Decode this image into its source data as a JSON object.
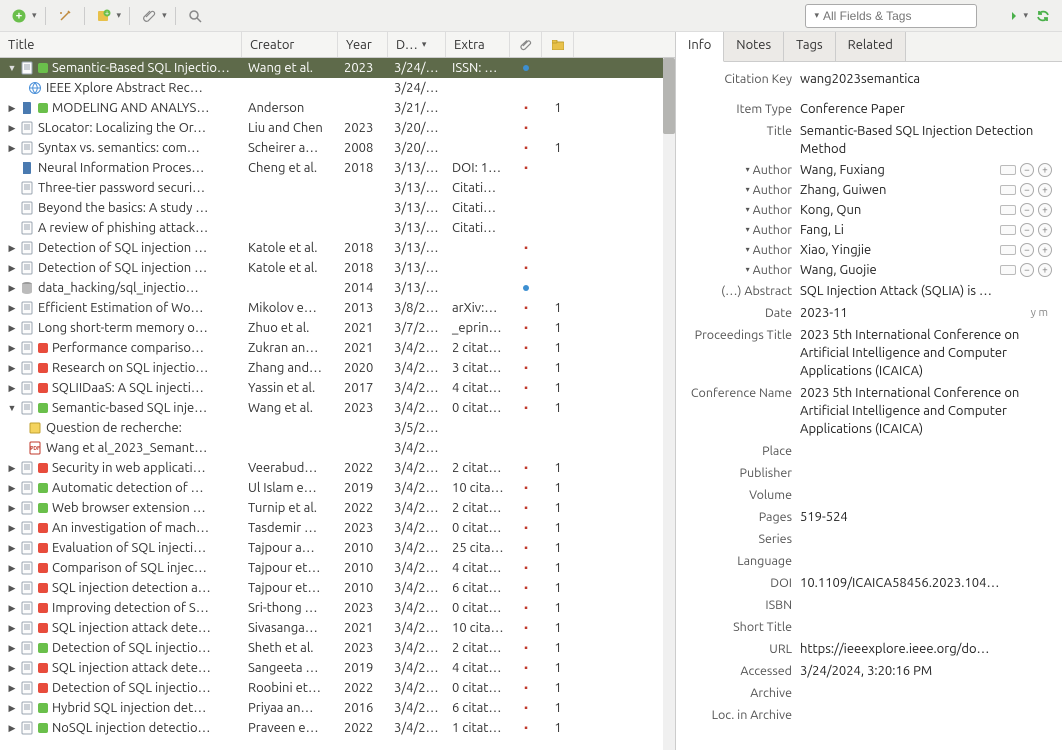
{
  "search": {
    "placeholder": "All Fields & Tags"
  },
  "columns": {
    "title": "Title",
    "creator": "Creator",
    "year": "Year",
    "date": "D…",
    "extra": "Extra"
  },
  "rows": [
    {
      "tw": "▼",
      "ic": "doc",
      "tg": "g",
      "title": "Semantic-Based SQL Injectio…",
      "creator": "Wang et al.",
      "year": "2023",
      "date": "3/24/…",
      "extra": "ISSN: …",
      "att": "dot",
      "f": "",
      "sel": true
    },
    {
      "tw": "",
      "ic": "web",
      "title": "IEEE Xplore Abstract Rec…",
      "creator": "",
      "year": "",
      "date": "3/24/…",
      "extra": "",
      "att": "",
      "f": "",
      "indent": 1
    },
    {
      "tw": "▶",
      "ic": "book",
      "tg": "g",
      "title": "MODELING AND ANALYS…",
      "creator": "Anderson",
      "year": "",
      "date": "3/21/…",
      "extra": "",
      "att": "pdf",
      "f": "1"
    },
    {
      "tw": "▶",
      "ic": "doc",
      "title": "SLocator: Localizing the Or…",
      "creator": "Liu and Chen",
      "year": "2023",
      "date": "3/20/…",
      "extra": "",
      "att": "pdf",
      "f": ""
    },
    {
      "tw": "▶",
      "ic": "doc",
      "title": "Syntax vs. semantics: com…",
      "creator": "Scheirer a…",
      "year": "2008",
      "date": "3/20/…",
      "extra": "",
      "att": "pdf",
      "f": "1"
    },
    {
      "tw": "",
      "ic": "book",
      "title": "Neural Information Proces…",
      "creator": "Cheng et al.",
      "year": "2018",
      "date": "3/13/…",
      "extra": "DOI: 1…",
      "att": "pdf",
      "f": ""
    },
    {
      "tw": "",
      "ic": "doc",
      "title": "Three-tier password securi…",
      "creator": "",
      "year": "",
      "date": "3/13/…",
      "extra": "Citati…",
      "att": "",
      "f": ""
    },
    {
      "tw": "",
      "ic": "doc",
      "title": "Beyond the basics: A study …",
      "creator": "",
      "year": "",
      "date": "3/13/…",
      "extra": "Citati…",
      "att": "",
      "f": ""
    },
    {
      "tw": "",
      "ic": "doc",
      "title": "A review of phishing attack…",
      "creator": "",
      "year": "",
      "date": "3/13/…",
      "extra": "Citati…",
      "att": "",
      "f": ""
    },
    {
      "tw": "▶",
      "ic": "doc",
      "title": "Detection of SQL injection …",
      "creator": "Katole et al.",
      "year": "2018",
      "date": "3/13/…",
      "extra": "",
      "att": "pdf",
      "f": ""
    },
    {
      "tw": "▶",
      "ic": "doc",
      "title": "Detection of SQL injection …",
      "creator": "Katole et al.",
      "year": "2018",
      "date": "3/13/…",
      "extra": "",
      "att": "pdf",
      "f": ""
    },
    {
      "tw": "▶",
      "ic": "db",
      "title": "data_hacking/sql_injectio…",
      "creator": "",
      "year": "2014",
      "date": "3/13/…",
      "extra": "",
      "att": "dot",
      "f": ""
    },
    {
      "tw": "▶",
      "ic": "doc",
      "title": "Efficient Estimation of Wo…",
      "creator": "Mikolov e…",
      "year": "2013",
      "date": "3/8/2…",
      "extra": "arXiv:…",
      "att": "pdf",
      "f": "1"
    },
    {
      "tw": "▶",
      "ic": "doc",
      "title": "Long short-term memory o…",
      "creator": "Zhuo et al.",
      "year": "2021",
      "date": "3/7/2…",
      "extra": "_eprin…",
      "att": "pdf",
      "f": "1"
    },
    {
      "tw": "▶",
      "ic": "doc",
      "tg": "r",
      "title": "Performance compariso…",
      "creator": "Zukran an…",
      "year": "2021",
      "date": "3/4/2…",
      "extra": "2 citat…",
      "att": "pdf",
      "f": "1"
    },
    {
      "tw": "▶",
      "ic": "doc",
      "tg": "r",
      "title": "Research on SQL injectio…",
      "creator": "Zhang and…",
      "year": "2020",
      "date": "3/4/2…",
      "extra": "3 citat…",
      "att": "pdf",
      "f": "1"
    },
    {
      "tw": "▶",
      "ic": "doc",
      "tg": "r",
      "title": "SQLIIDaaS: A SQL injecti…",
      "creator": "Yassin et al.",
      "year": "2017",
      "date": "3/4/2…",
      "extra": "4 citat…",
      "att": "pdf",
      "f": "1"
    },
    {
      "tw": "▼",
      "ic": "doc",
      "tg": "g",
      "title": "Semantic-based SQL inje…",
      "creator": "Wang et al.",
      "year": "2023",
      "date": "3/4/2…",
      "extra": "0 citat…",
      "att": "pdf",
      "f": "1"
    },
    {
      "tw": "",
      "ic": "note",
      "title": "Question de recherche:",
      "creator": "",
      "year": "",
      "date": "3/5/2…",
      "extra": "",
      "att": "",
      "f": "",
      "indent": 1
    },
    {
      "tw": "",
      "ic": "pdf",
      "title": "Wang et al_2023_Semant…",
      "creator": "",
      "year": "",
      "date": "3/4/2…",
      "extra": "",
      "att": "",
      "f": "",
      "indent": 1
    },
    {
      "tw": "▶",
      "ic": "doc",
      "tg": "r",
      "title": "Security in web applicati…",
      "creator": "Veerabud…",
      "year": "2022",
      "date": "3/4/2…",
      "extra": "2 citat…",
      "att": "pdf",
      "f": "1"
    },
    {
      "tw": "▶",
      "ic": "doc",
      "tg": "g",
      "title": "Automatic detection of …",
      "creator": "Ul Islam e…",
      "year": "2019",
      "date": "3/4/2…",
      "extra": "10 cita…",
      "att": "pdf",
      "f": "1"
    },
    {
      "tw": "▶",
      "ic": "doc",
      "tg": "g",
      "title": "Web browser extension …",
      "creator": "Turnip et al.",
      "year": "2022",
      "date": "3/4/2…",
      "extra": "2 citat…",
      "att": "pdf",
      "f": "1"
    },
    {
      "tw": "▶",
      "ic": "doc",
      "tg": "r",
      "title": "An investigation of mach…",
      "creator": "Tasdemir …",
      "year": "2023",
      "date": "3/4/2…",
      "extra": "0 citat…",
      "att": "pdf",
      "f": "1"
    },
    {
      "tw": "▶",
      "ic": "doc",
      "tg": "r",
      "title": "Evaluation of SQL injecti…",
      "creator": "Tajpour a…",
      "year": "2010",
      "date": "3/4/2…",
      "extra": "25 cita…",
      "att": "pdf",
      "f": "1"
    },
    {
      "tw": "▶",
      "ic": "doc",
      "tg": "r",
      "title": "Comparison of SQL injec…",
      "creator": "Tajpour et…",
      "year": "2010",
      "date": "3/4/2…",
      "extra": "4 citat…",
      "att": "pdf",
      "f": "1"
    },
    {
      "tw": "▶",
      "ic": "doc",
      "tg": "r",
      "title": "SQL injection detection a…",
      "creator": "Tajpour et…",
      "year": "2010",
      "date": "3/4/2…",
      "extra": "6 citat…",
      "att": "pdf",
      "f": "1"
    },
    {
      "tw": "▶",
      "ic": "doc",
      "tg": "r",
      "title": "Improving detection of S…",
      "creator": "Sri-thong …",
      "year": "2023",
      "date": "3/4/2…",
      "extra": "0 citat…",
      "att": "pdf",
      "f": "1"
    },
    {
      "tw": "▶",
      "ic": "doc",
      "tg": "r",
      "title": "SQL injection attack dete…",
      "creator": "Sivasanga…",
      "year": "2021",
      "date": "3/4/2…",
      "extra": "10 cita…",
      "att": "pdf",
      "f": "1"
    },
    {
      "tw": "▶",
      "ic": "doc",
      "tg": "g",
      "title": "Detection of SQL injectio…",
      "creator": "Sheth et al.",
      "year": "2023",
      "date": "3/4/2…",
      "extra": "2 citat…",
      "att": "pdf",
      "f": "1"
    },
    {
      "tw": "▶",
      "ic": "doc",
      "tg": "r",
      "title": "SQL injection attack dete…",
      "creator": "Sangeeta …",
      "year": "2019",
      "date": "3/4/2…",
      "extra": "4 citat…",
      "att": "pdf",
      "f": "1"
    },
    {
      "tw": "▶",
      "ic": "doc",
      "tg": "r",
      "title": "Detection of SQL injectio…",
      "creator": "Roobini et…",
      "year": "2022",
      "date": "3/4/2…",
      "extra": "0 citat…",
      "att": "pdf",
      "f": "1"
    },
    {
      "tw": "▶",
      "ic": "doc",
      "tg": "g",
      "title": "Hybrid SQL injection det…",
      "creator": "Priyaa an…",
      "year": "2016",
      "date": "3/4/2…",
      "extra": "6 citat…",
      "att": "pdf",
      "f": "1"
    },
    {
      "tw": "▶",
      "ic": "doc",
      "tg": "g",
      "title": "NoSQL injection detectio…",
      "creator": "Praveen e…",
      "year": "2022",
      "date": "3/4/2…",
      "extra": "1 citat…",
      "att": "pdf",
      "f": "1"
    }
  ],
  "tabs": [
    "Info",
    "Notes",
    "Tags",
    "Related"
  ],
  "activeTab": 0,
  "detail": {
    "citationKeyLabel": "Citation Key",
    "citationKey": "wang2023semantica",
    "itemTypeLabel": "Item Type",
    "itemType": "Conference Paper",
    "titleLabel": "Title",
    "titleVal": "Semantic-Based SQL Injection Detection Method",
    "authorLabel": "Author",
    "authors": [
      "Wang, Fuxiang",
      "Zhang, Guiwen",
      "Kong, Qun",
      "Fang, Li",
      "Xiao, Yingjie",
      "Wang, Guojie"
    ],
    "abstractLabel": "(…) Abstract",
    "abstractVal": "SQL Injection Attack (SQLIA) is …",
    "dateLabel": "Date",
    "dateVal": "2023-11",
    "dateYm": "y m",
    "procLabel": "Proceedings Title",
    "procVal": "2023 5th International Conference on Artificial Intelligence and Computer Applications (ICAICA)",
    "confLabel": "Conference Name",
    "confVal": "2023 5th International Conference on Artificial Intelligence and Computer Applications (ICAICA)",
    "placeLabel": "Place",
    "placeVal": "",
    "publisherLabel": "Publisher",
    "publisherVal": "",
    "volumeLabel": "Volume",
    "volumeVal": "",
    "pagesLabel": "Pages",
    "pagesVal": "519-524",
    "seriesLabel": "Series",
    "seriesVal": "",
    "languageLabel": "Language",
    "languageVal": "",
    "doiLabel": "DOI",
    "doiVal": "10.1109/ICAICA58456.2023.104…",
    "isbnLabel": "ISBN",
    "isbnVal": "",
    "shortLabel": "Short Title",
    "shortVal": "",
    "urlLabel": "URL",
    "urlVal": "https://ieeexplore.ieee.org/do…",
    "accessedLabel": "Accessed",
    "accessedVal": "3/24/2024, 3:20:16 PM",
    "archiveLabel": "Archive",
    "archiveVal": "",
    "locArchiveLabel": "Loc. in Archive",
    "locArchiveVal": ""
  }
}
